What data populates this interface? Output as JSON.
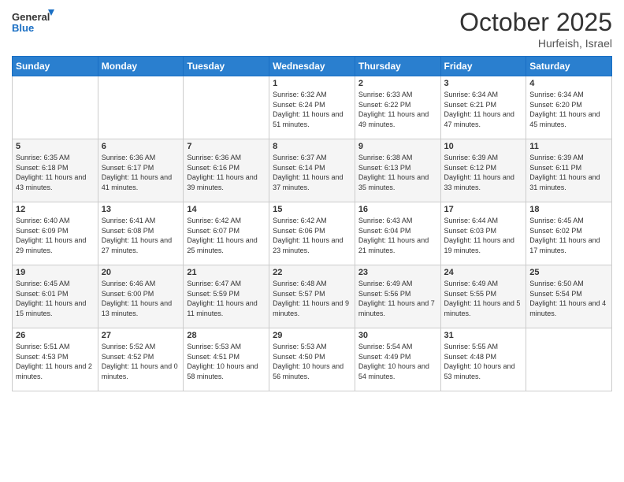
{
  "header": {
    "logo_general": "General",
    "logo_blue": "Blue",
    "month_title": "October 2025",
    "location": "Hurfeish, Israel"
  },
  "days_of_week": [
    "Sunday",
    "Monday",
    "Tuesday",
    "Wednesday",
    "Thursday",
    "Friday",
    "Saturday"
  ],
  "weeks": [
    [
      {
        "day": "",
        "sunrise": "",
        "sunset": "",
        "daylight": ""
      },
      {
        "day": "",
        "sunrise": "",
        "sunset": "",
        "daylight": ""
      },
      {
        "day": "",
        "sunrise": "",
        "sunset": "",
        "daylight": ""
      },
      {
        "day": "1",
        "sunrise": "Sunrise: 6:32 AM",
        "sunset": "Sunset: 6:24 PM",
        "daylight": "Daylight: 11 hours and 51 minutes."
      },
      {
        "day": "2",
        "sunrise": "Sunrise: 6:33 AM",
        "sunset": "Sunset: 6:22 PM",
        "daylight": "Daylight: 11 hours and 49 minutes."
      },
      {
        "day": "3",
        "sunrise": "Sunrise: 6:34 AM",
        "sunset": "Sunset: 6:21 PM",
        "daylight": "Daylight: 11 hours and 47 minutes."
      },
      {
        "day": "4",
        "sunrise": "Sunrise: 6:34 AM",
        "sunset": "Sunset: 6:20 PM",
        "daylight": "Daylight: 11 hours and 45 minutes."
      }
    ],
    [
      {
        "day": "5",
        "sunrise": "Sunrise: 6:35 AM",
        "sunset": "Sunset: 6:18 PM",
        "daylight": "Daylight: 11 hours and 43 minutes."
      },
      {
        "day": "6",
        "sunrise": "Sunrise: 6:36 AM",
        "sunset": "Sunset: 6:17 PM",
        "daylight": "Daylight: 11 hours and 41 minutes."
      },
      {
        "day": "7",
        "sunrise": "Sunrise: 6:36 AM",
        "sunset": "Sunset: 6:16 PM",
        "daylight": "Daylight: 11 hours and 39 minutes."
      },
      {
        "day": "8",
        "sunrise": "Sunrise: 6:37 AM",
        "sunset": "Sunset: 6:14 PM",
        "daylight": "Daylight: 11 hours and 37 minutes."
      },
      {
        "day": "9",
        "sunrise": "Sunrise: 6:38 AM",
        "sunset": "Sunset: 6:13 PM",
        "daylight": "Daylight: 11 hours and 35 minutes."
      },
      {
        "day": "10",
        "sunrise": "Sunrise: 6:39 AM",
        "sunset": "Sunset: 6:12 PM",
        "daylight": "Daylight: 11 hours and 33 minutes."
      },
      {
        "day": "11",
        "sunrise": "Sunrise: 6:39 AM",
        "sunset": "Sunset: 6:11 PM",
        "daylight": "Daylight: 11 hours and 31 minutes."
      }
    ],
    [
      {
        "day": "12",
        "sunrise": "Sunrise: 6:40 AM",
        "sunset": "Sunset: 6:09 PM",
        "daylight": "Daylight: 11 hours and 29 minutes."
      },
      {
        "day": "13",
        "sunrise": "Sunrise: 6:41 AM",
        "sunset": "Sunset: 6:08 PM",
        "daylight": "Daylight: 11 hours and 27 minutes."
      },
      {
        "day": "14",
        "sunrise": "Sunrise: 6:42 AM",
        "sunset": "Sunset: 6:07 PM",
        "daylight": "Daylight: 11 hours and 25 minutes."
      },
      {
        "day": "15",
        "sunrise": "Sunrise: 6:42 AM",
        "sunset": "Sunset: 6:06 PM",
        "daylight": "Daylight: 11 hours and 23 minutes."
      },
      {
        "day": "16",
        "sunrise": "Sunrise: 6:43 AM",
        "sunset": "Sunset: 6:04 PM",
        "daylight": "Daylight: 11 hours and 21 minutes."
      },
      {
        "day": "17",
        "sunrise": "Sunrise: 6:44 AM",
        "sunset": "Sunset: 6:03 PM",
        "daylight": "Daylight: 11 hours and 19 minutes."
      },
      {
        "day": "18",
        "sunrise": "Sunrise: 6:45 AM",
        "sunset": "Sunset: 6:02 PM",
        "daylight": "Daylight: 11 hours and 17 minutes."
      }
    ],
    [
      {
        "day": "19",
        "sunrise": "Sunrise: 6:45 AM",
        "sunset": "Sunset: 6:01 PM",
        "daylight": "Daylight: 11 hours and 15 minutes."
      },
      {
        "day": "20",
        "sunrise": "Sunrise: 6:46 AM",
        "sunset": "Sunset: 6:00 PM",
        "daylight": "Daylight: 11 hours and 13 minutes."
      },
      {
        "day": "21",
        "sunrise": "Sunrise: 6:47 AM",
        "sunset": "Sunset: 5:59 PM",
        "daylight": "Daylight: 11 hours and 11 minutes."
      },
      {
        "day": "22",
        "sunrise": "Sunrise: 6:48 AM",
        "sunset": "Sunset: 5:57 PM",
        "daylight": "Daylight: 11 hours and 9 minutes."
      },
      {
        "day": "23",
        "sunrise": "Sunrise: 6:49 AM",
        "sunset": "Sunset: 5:56 PM",
        "daylight": "Daylight: 11 hours and 7 minutes."
      },
      {
        "day": "24",
        "sunrise": "Sunrise: 6:49 AM",
        "sunset": "Sunset: 5:55 PM",
        "daylight": "Daylight: 11 hours and 5 minutes."
      },
      {
        "day": "25",
        "sunrise": "Sunrise: 6:50 AM",
        "sunset": "Sunset: 5:54 PM",
        "daylight": "Daylight: 11 hours and 4 minutes."
      }
    ],
    [
      {
        "day": "26",
        "sunrise": "Sunrise: 5:51 AM",
        "sunset": "Sunset: 4:53 PM",
        "daylight": "Daylight: 11 hours and 2 minutes."
      },
      {
        "day": "27",
        "sunrise": "Sunrise: 5:52 AM",
        "sunset": "Sunset: 4:52 PM",
        "daylight": "Daylight: 11 hours and 0 minutes."
      },
      {
        "day": "28",
        "sunrise": "Sunrise: 5:53 AM",
        "sunset": "Sunset: 4:51 PM",
        "daylight": "Daylight: 10 hours and 58 minutes."
      },
      {
        "day": "29",
        "sunrise": "Sunrise: 5:53 AM",
        "sunset": "Sunset: 4:50 PM",
        "daylight": "Daylight: 10 hours and 56 minutes."
      },
      {
        "day": "30",
        "sunrise": "Sunrise: 5:54 AM",
        "sunset": "Sunset: 4:49 PM",
        "daylight": "Daylight: 10 hours and 54 minutes."
      },
      {
        "day": "31",
        "sunrise": "Sunrise: 5:55 AM",
        "sunset": "Sunset: 4:48 PM",
        "daylight": "Daylight: 10 hours and 53 minutes."
      },
      {
        "day": "",
        "sunrise": "",
        "sunset": "",
        "daylight": ""
      }
    ]
  ]
}
